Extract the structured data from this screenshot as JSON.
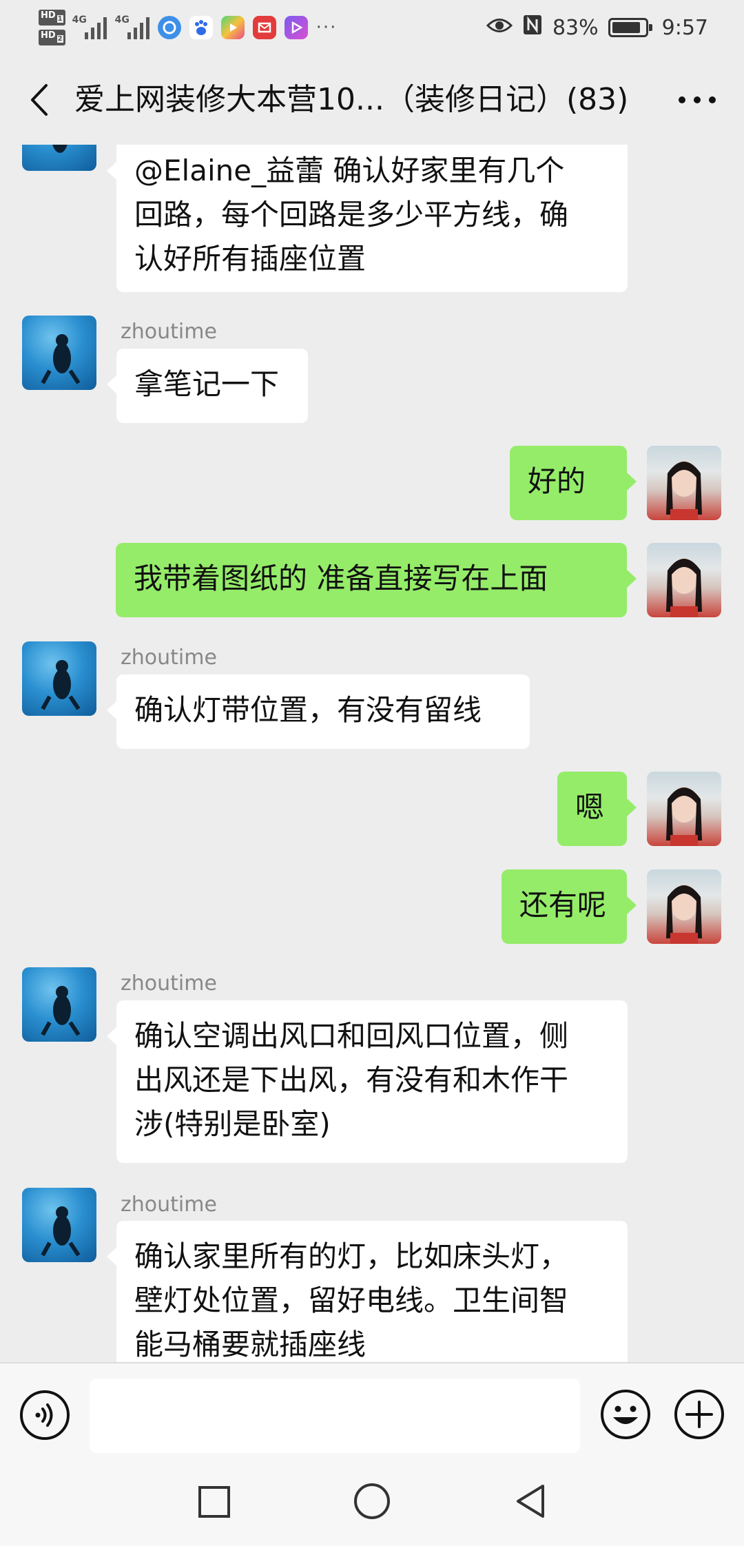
{
  "status_bar": {
    "hd1": "HD",
    "hd1_sub": "1",
    "hd2": "HD",
    "hd2_sub": "2",
    "net1": "4G",
    "net2": "4G",
    "more": "···",
    "battery_percent": "83%",
    "time": "9:57",
    "icons": [
      "eye-icon",
      "nfc-icon",
      "battery-icon"
    ],
    "app_icons": [
      "browser-icon",
      "baidu-icon",
      "video-icon",
      "mail-icon",
      "player-icon"
    ]
  },
  "header": {
    "title": "爱上网装修大本营10...（装修日记）(83)",
    "back_icon": "chevron-left-icon",
    "more_icon": "more-dots-icon"
  },
  "messages": [
    {
      "side": "left",
      "sender": "",
      "text_lines": [
        "@Elaine_益蕾  确认好家里有几个",
        "回路，每个回路是多少平方线，确",
        "认好所有插座位置"
      ]
    },
    {
      "side": "left",
      "sender": "zhoutime",
      "text_lines": [
        "拿笔记一下"
      ]
    },
    {
      "side": "right",
      "text_lines": [
        "好的"
      ]
    },
    {
      "side": "right",
      "text_lines": [
        "我带着图纸的   准备直接写在上面"
      ]
    },
    {
      "side": "left",
      "sender": "zhoutime",
      "text_lines": [
        "确认灯带位置，有没有留线"
      ]
    },
    {
      "side": "right",
      "text_lines": [
        "嗯"
      ]
    },
    {
      "side": "right",
      "text_lines": [
        "还有呢"
      ]
    },
    {
      "side": "left",
      "sender": "zhoutime",
      "text_lines": [
        "确认空调出风口和回风口位置，侧",
        "出风还是下出风，有没有和木作干",
        "涉(特别是卧室)"
      ]
    },
    {
      "side": "left",
      "sender": "zhoutime",
      "text_lines": [
        "确认家里所有的灯，比如床头灯，",
        "壁灯处位置，留好电线。卫生间智",
        "能马桶要就插座线"
      ]
    }
  ],
  "input_bar": {
    "placeholder": "",
    "voice_icon": "voice-icon",
    "emoji_icon": "emoji-icon",
    "plus_icon": "plus-icon"
  },
  "nav_bar": {
    "recent_icon": "square-icon",
    "home_icon": "circle-icon",
    "back_icon": "triangle-back-icon"
  },
  "colors": {
    "background": "#ededed",
    "bubble_self": "#95ec69",
    "bubble_other": "#ffffff"
  }
}
